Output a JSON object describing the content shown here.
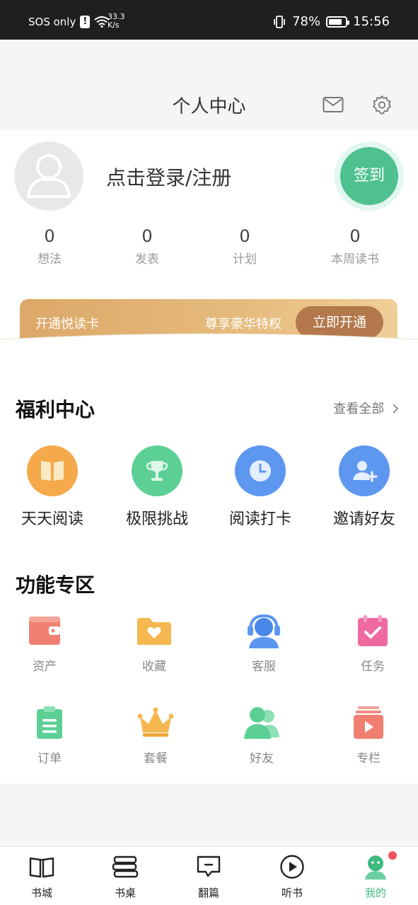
{
  "status_bar": {
    "carrier": "SOS only",
    "alert_glyph": "!",
    "net_speed_value": "33.3",
    "net_speed_unit": "K/s",
    "battery": "78%",
    "time": "15:56"
  },
  "header": {
    "title": "个人中心",
    "icons": [
      "mail-icon",
      "gear-icon"
    ]
  },
  "profile": {
    "login_text": "点击登录/注册",
    "checkin_label": "签到",
    "stats": [
      {
        "value": "0",
        "label": "想法"
      },
      {
        "value": "0",
        "label": "发表"
      },
      {
        "value": "0",
        "label": "计划"
      },
      {
        "value": "0",
        "label": "本周读书"
      }
    ]
  },
  "vip": {
    "title": "开通悦读卡",
    "subtitle": "尊享豪华特权",
    "button": "立即开通"
  },
  "welfare": {
    "title": "福利中心",
    "see_all": "查看全部",
    "items": [
      {
        "label": "天天阅读",
        "icon": "book-icon",
        "color": "#f5a94b"
      },
      {
        "label": "极限挑战",
        "icon": "trophy-icon",
        "color": "#5ccf95"
      },
      {
        "label": "阅读打卡",
        "icon": "clock-icon",
        "color": "#5d97f0"
      },
      {
        "label": "邀请好友",
        "icon": "add-user-icon",
        "color": "#5d97f0"
      }
    ]
  },
  "features": {
    "title": "功能专区",
    "items": [
      {
        "label": "资产",
        "icon": "wallet-icon"
      },
      {
        "label": "收藏",
        "icon": "folder-heart-icon"
      },
      {
        "label": "客服",
        "icon": "support-icon"
      },
      {
        "label": "任务",
        "icon": "calendar-check-icon"
      },
      {
        "label": "订单",
        "icon": "clipboard-icon"
      },
      {
        "label": "套餐",
        "icon": "crown-icon"
      },
      {
        "label": "好友",
        "icon": "friends-icon"
      },
      {
        "label": "专栏",
        "icon": "video-column-icon"
      }
    ]
  },
  "tabbar": {
    "items": [
      {
        "label": "书城",
        "icon": "open-book-icon"
      },
      {
        "label": "书桌",
        "icon": "book-stack-icon"
      },
      {
        "label": "翻篇",
        "icon": "chat-icon"
      },
      {
        "label": "听书",
        "icon": "play-icon"
      },
      {
        "label": "我的",
        "icon": "profile-icon"
      }
    ],
    "active_index": 4,
    "active_color": "#3fb881"
  }
}
